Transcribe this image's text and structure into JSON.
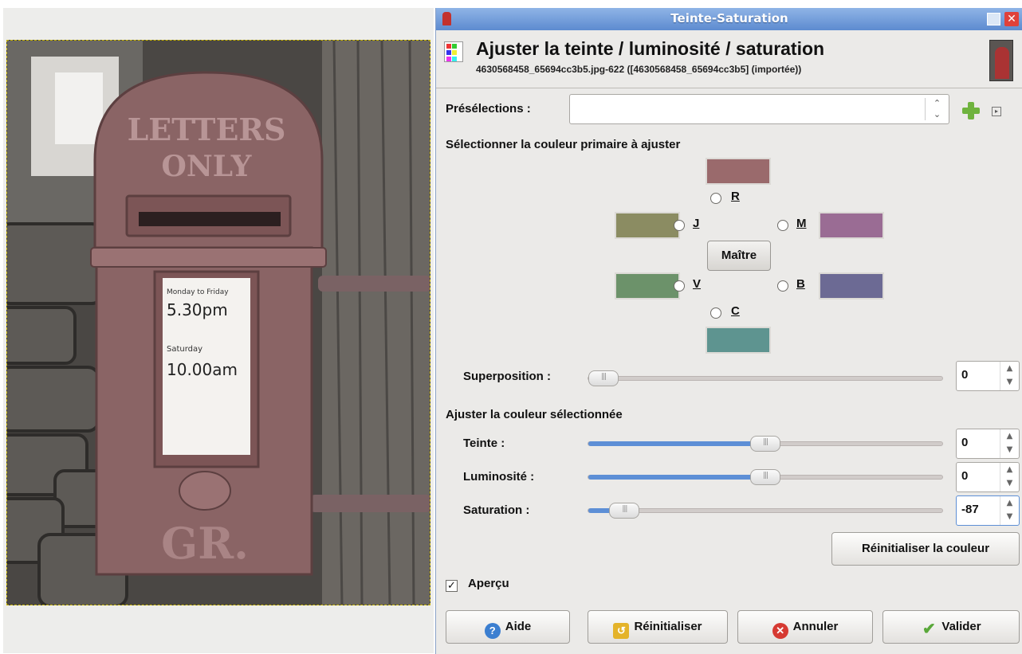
{
  "dialog": {
    "window_title": "Teinte-Saturation",
    "heading": "Ajuster la teinte / luminosité / saturation",
    "subheading": "4630568458_65694cc3b5.jpg-622 ([4630568458_65694cc3b5] (importée))"
  },
  "presets": {
    "label": "Présélections :",
    "value": ""
  },
  "primary_color": {
    "heading": "Sélectionner la couleur primaire à ajuster",
    "options": [
      {
        "key": "R",
        "label": "R",
        "color": "#9a6a6c"
      },
      {
        "key": "J",
        "label": "J",
        "color": "#8b8c62"
      },
      {
        "key": "M",
        "label": "M",
        "color": "#9a6c94"
      },
      {
        "key": "V",
        "label": "V",
        "color": "#6c926a"
      },
      {
        "key": "B",
        "label": "B",
        "color": "#6c6a94"
      },
      {
        "key": "C",
        "label": "C",
        "color": "#5e9490"
      }
    ],
    "master_label": "Maître",
    "selected": "Maître"
  },
  "overlap": {
    "label": "Superposition :",
    "value": "0",
    "fraction": 0
  },
  "adjust": {
    "heading": "Ajuster la couleur sélectionnée",
    "hue": {
      "label": "Teinte :",
      "value": "0",
      "fraction": 0.5
    },
    "lightness": {
      "label": "Luminosité :",
      "value": "0",
      "fraction": 0.5
    },
    "saturation": {
      "label": "Saturation :",
      "value": "-87",
      "fraction": 0.065
    }
  },
  "reset_color_label": "Réinitialiser la couleur",
  "preview": {
    "label": "Aperçu",
    "checked": true,
    "check_mark": "✓"
  },
  "buttons": {
    "help": "Aide",
    "reset": "Réinitialiser",
    "cancel": "Annuler",
    "ok": "Valider"
  },
  "image_text": {
    "mailbox_line1": "LETTERS",
    "mailbox_line2": "ONLY",
    "cipher": "GR.",
    "notice_days": "Monday to Friday",
    "notice_time1": "5.30pm",
    "notice_sat": "Saturday",
    "notice_time2": "10.00am"
  },
  "colors": {
    "accent": "#5d8fd6",
    "titlebar": "#6f9bd9",
    "postbox": "#8a6465"
  }
}
